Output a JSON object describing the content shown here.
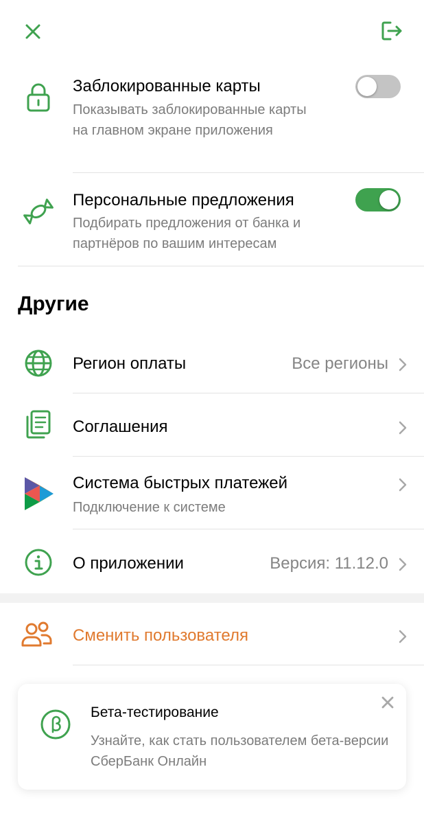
{
  "colors": {
    "accent_green": "#3fa24f",
    "toggle_off": "#c4c4c4",
    "orange": "#e07a2f",
    "muted_text": "#7c7c7c"
  },
  "topbar": {
    "close_icon": "close-icon",
    "logout_icon": "logout-icon"
  },
  "settings": [
    {
      "icon": "lock-icon",
      "title": "Заблокированные карты",
      "subtitle": "Показывать заблокированные карты на главном экране приложения",
      "toggle": "off"
    },
    {
      "icon": "candy-icon",
      "title": "Персональные предложения",
      "subtitle": "Подбирать предложения от банка и партнёров по вашим интересам",
      "toggle": "on"
    }
  ],
  "others": {
    "section_title": "Другие",
    "items": [
      {
        "icon": "globe-icon",
        "title": "Регион оплаты",
        "value": "Все регионы"
      },
      {
        "icon": "documents-icon",
        "title": "Соглашения",
        "value": ""
      },
      {
        "icon": "sbp-logo-icon",
        "title": "Система быстрых платежей",
        "subtitle": "Подключение к системе"
      },
      {
        "icon": "info-icon",
        "title": "О приложении",
        "value": "Версия: 11.12.0"
      }
    ]
  },
  "switch_user": {
    "icon": "users-icon",
    "label": "Сменить пользователя"
  },
  "beta": {
    "icon": "beta-icon",
    "title": "Бета-тестирование",
    "subtitle": "Узнайте, как стать пользователем бета-версии СберБанк Онлайн"
  }
}
